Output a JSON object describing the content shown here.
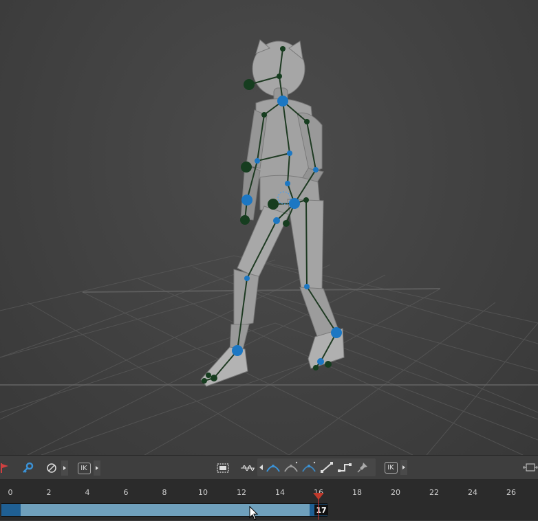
{
  "toolbar": {
    "ik_label_left": "IK",
    "ik_label_right": "IK",
    "icons": [
      "flag-icon",
      "key-icon",
      "no-entry-icon",
      "frame-icon",
      "waveform-icon",
      "auto-tangent-icon",
      "smooth-tangent-icon",
      "linear-auto-tangent-icon",
      "linear-tangent-icon",
      "step-tangent-icon",
      "pin-tangent-icon",
      "fit-icon"
    ]
  },
  "timeline": {
    "ticks": [
      "0",
      "2",
      "4",
      "6",
      "8",
      "10",
      "12",
      "14",
      "16",
      "18",
      "20",
      "22",
      "24",
      "26"
    ],
    "current_frame": "17",
    "marker_frame": 16,
    "range_start": 0,
    "range_end": 17
  },
  "colors": {
    "bone": "#1e3a22",
    "joint_blue": "#1c77c3",
    "joint_dark": "#163d1f",
    "range": "#6fa0bc",
    "range_dark": "#1f5f93",
    "playhead": "#c0392b"
  }
}
